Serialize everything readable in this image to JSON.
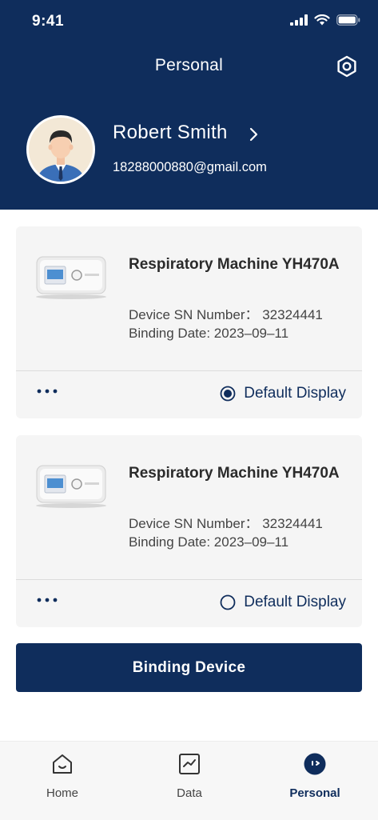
{
  "status_bar": {
    "time": "9:41"
  },
  "header": {
    "title": "Personal",
    "profile": {
      "name": "Robert Smith",
      "email": "18288000880@gmail.com"
    }
  },
  "devices": [
    {
      "name": "Respiratory Machine YH470A",
      "sn": "Device SN Number： 32324441",
      "binding_date": "Binding Date: 2023–09–11",
      "default_label": "Default Display",
      "is_default": true
    },
    {
      "name": "Respiratory Machine YH470A",
      "sn": "Device SN Number： 32324441",
      "binding_date": "Binding Date: 2023–09–11",
      "default_label": "Default Display",
      "is_default": false
    }
  ],
  "actions": {
    "binding_device": "Binding Device"
  },
  "tabbar": {
    "items": [
      {
        "label": "Home",
        "icon": "home-icon",
        "active": false
      },
      {
        "label": "Data",
        "icon": "chart-icon",
        "active": false
      },
      {
        "label": "Personal",
        "icon": "person-icon",
        "active": true
      }
    ]
  },
  "colors": {
    "primary": "#0f2d5c",
    "card_bg": "#f5f5f5"
  }
}
